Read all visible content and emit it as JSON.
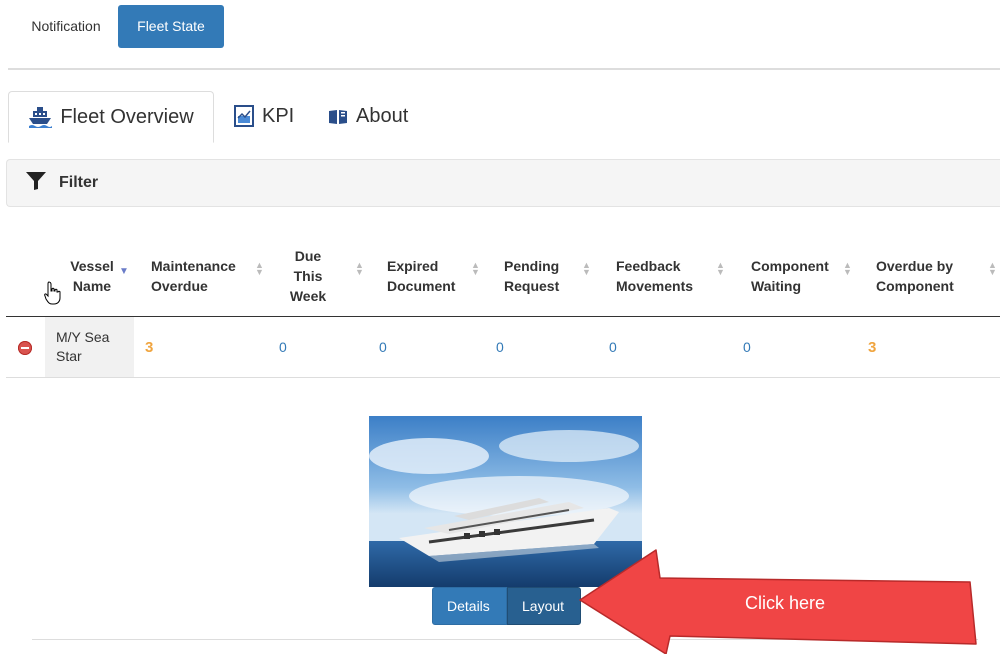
{
  "nav": {
    "items": [
      {
        "label": "Notification",
        "active": false
      },
      {
        "label": "Fleet State",
        "active": true
      }
    ]
  },
  "tabs": [
    {
      "label": "Fleet Overview",
      "icon": "ship-icon",
      "active": true
    },
    {
      "label": "KPI",
      "icon": "chart-document-icon",
      "active": false
    },
    {
      "label": "About",
      "icon": "info-book-icon",
      "active": false
    }
  ],
  "filter": {
    "label": "Filter",
    "icon": "filter-funnel-icon"
  },
  "table": {
    "columns": [
      {
        "label": "Vessel Name",
        "lines": [
          "Vessel",
          "Name"
        ],
        "sort": "desc"
      },
      {
        "label": "Maintenance Overdue",
        "lines": [
          "Maintenance",
          "Overdue"
        ],
        "sort": "both"
      },
      {
        "label": "Due This Week",
        "lines": [
          "Due",
          "This",
          "Week"
        ],
        "sort": "both"
      },
      {
        "label": "Expired Document",
        "lines": [
          "Expired",
          "Document"
        ],
        "sort": "both"
      },
      {
        "label": "Pending Request",
        "lines": [
          "Pending",
          "Request"
        ],
        "sort": "both"
      },
      {
        "label": "Feedback Movements",
        "lines": [
          "Feedback",
          "Movements"
        ],
        "sort": "both"
      },
      {
        "label": "Component Waiting",
        "lines": [
          "Component",
          "Waiting"
        ],
        "sort": "both"
      },
      {
        "label": "Overdue by Component",
        "lines": [
          "Overdue by",
          "Component"
        ],
        "sort": "both"
      }
    ],
    "rows": [
      {
        "vessel_name_lines": [
          "M/Y Sea",
          "Star"
        ],
        "maintenance_overdue": "3",
        "due_this_week": "0",
        "expired_document": "0",
        "pending_request": "0",
        "feedback_movements": "0",
        "component_waiting": "0",
        "overdue_by_component": "3"
      }
    ]
  },
  "vessel_panel": {
    "image": "yacht-photo",
    "details_label": "Details",
    "layout_label": "Layout"
  },
  "callout": {
    "text": "Click here",
    "color": "#f04545"
  },
  "colors": {
    "primary": "#337ab7",
    "primary_dark": "#286090",
    "warning": "#f0a540",
    "danger": "#d9534f",
    "link": "#337ab7"
  }
}
